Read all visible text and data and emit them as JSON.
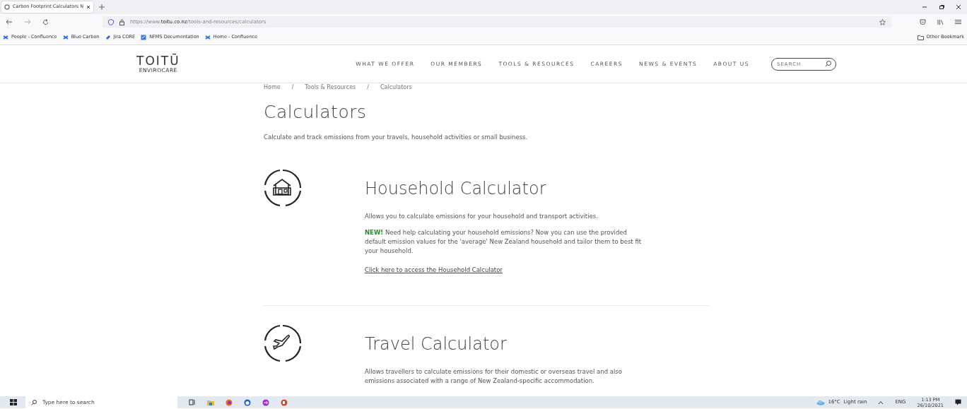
{
  "browser": {
    "tabs": [
      {
        "title": "Carbon Footprint Calculators N",
        "selected": true
      }
    ],
    "url_prefix": "https://www.",
    "url_domain": "toitu.co.nz",
    "url_path": "/tools-and-resources/calculators",
    "bookmarks": [
      {
        "label": "People - Confluence",
        "kind": "confluence"
      },
      {
        "label": "Blue Carbon",
        "kind": "confluence"
      },
      {
        "label": "Jira CORE",
        "kind": "jira"
      },
      {
        "label": "NFMS Documentation",
        "kind": "doc"
      },
      {
        "label": "Home - Confluence",
        "kind": "confluence"
      }
    ],
    "other_bookmarks": "Other Bookmark"
  },
  "site": {
    "logo": "TOITŪ",
    "logo_sub": "ENVIROCARE",
    "nav": [
      "WHAT WE OFFER",
      "OUR MEMBERS",
      "TOOLS & RESOURCES",
      "CAREERS",
      "NEWS & EVENTS",
      "ABOUT US"
    ],
    "search": {
      "placeholder": "SEARCH"
    }
  },
  "breadcrumb": {
    "items": [
      "Home",
      "Tools & Resources",
      "Calculators"
    ],
    "separator": "/"
  },
  "page": {
    "title": "Calculators",
    "intro": "Calculate and track emissions from your travels, household activities or small business."
  },
  "sections": [
    {
      "kind": "house",
      "title": "Household Calculator",
      "paragraphs": [
        "Allows you to calculate emissions for your household and transport activities.",
        "**NEW!** Need help calculating your household emissions? Now you can use the provided default emission values for the 'average' New Zealand household and tailor them to best fit your household."
      ],
      "link": "Click here to access the Household Calculator"
    },
    {
      "kind": "plane",
      "title": "Travel Calculator",
      "paragraphs": [
        "Allows travellers to calculate emissions for their domestic or overseas travel and also emissions associated with a range of New Zealand-specific accommodation."
      ]
    }
  ],
  "taskbar": {
    "search_placeholder": "Type here to search",
    "weather": "16°C  Light rain",
    "lang": "ENG",
    "time": "1:13 PM",
    "date": "26/10/2021"
  }
}
